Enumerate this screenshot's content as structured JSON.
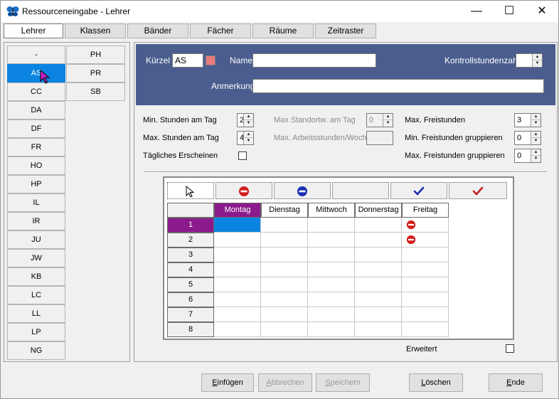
{
  "window": {
    "title": "Ressourceneingabe - Lehrer",
    "minimize": "—",
    "maximize": "☐",
    "close": "✕"
  },
  "tabs": [
    {
      "label": "Lehrer"
    },
    {
      "label": "Klassen"
    },
    {
      "label": "Bänder"
    },
    {
      "label": "Fächer"
    },
    {
      "label": "Räume"
    },
    {
      "label": "Zeitraster"
    }
  ],
  "teachers": {
    "col1": [
      "-",
      "AS",
      "CC",
      "DA",
      "DF",
      "FR",
      "HO",
      "HP",
      "IL",
      "IR",
      "JU",
      "JW",
      "KB",
      "LC",
      "LL",
      "LP",
      "NG"
    ],
    "col2": [
      "PH",
      "PR",
      "SB"
    ],
    "selected": "AS"
  },
  "header": {
    "kuerzel_label": "Kürzel",
    "kuerzel_value": "AS",
    "name_label": "Name",
    "name_value": "",
    "kontroll_label": "Kontrollstundenzahl",
    "kontroll_value": "",
    "anmerkung_label": "Anmerkung",
    "anmerkung_value": ""
  },
  "settings": {
    "min_stunden_label": "Min. Stunden am Tag",
    "min_stunden_value": "2",
    "max_stunden_label": "Max. Stunden am Tag",
    "max_stunden_value": "4",
    "taegliches_label": "Tägliches Erscheinen",
    "max_standortw_label": "Max Standortw. am Tag",
    "max_standortw_value": "0",
    "max_arbeits_label": "Max. Arbeitsstunden/Woch",
    "max_arbeits_value": "",
    "max_frei_label": "Max. Freistunden",
    "max_frei_value": "3",
    "min_frei_grp_label": "Min. Freistunden gruppieren",
    "min_frei_grp_value": "0",
    "max_frei_grp_label": "Max. Freistunden gruppieren",
    "max_frei_grp_value": "0"
  },
  "grid": {
    "days": [
      "Montag",
      "Dienstag",
      "Mittwoch",
      "Donnerstag",
      "Freitag"
    ],
    "periods": [
      "1",
      "2",
      "3",
      "4",
      "5",
      "6",
      "7",
      "8"
    ],
    "active_day": "Montag",
    "active_period": "1",
    "blocked": [
      {
        "day": "Freitag",
        "period": "1"
      },
      {
        "day": "Freitag",
        "period": "2"
      }
    ],
    "tool_icons": [
      "arrow-icon",
      "red-minus-icon",
      "blue-minus-icon",
      "empty",
      "blue-check-icon",
      "red-check-icon"
    ]
  },
  "erweitert_label": "Erweitert",
  "buttons": {
    "einfuegen_pre": "",
    "einfuegen_ul": "E",
    "einfuegen_post": "infügen",
    "abbrechen_pre": "",
    "abbrechen_ul": "A",
    "abbrechen_post": "bbrechen",
    "speichern_pre": "",
    "speichern_ul": "S",
    "speichern_post": "peichern",
    "loeschen_pre": "",
    "loeschen_ul": "L",
    "loeschen_post": "öschen",
    "ende_pre": "",
    "ende_ul": "E",
    "ende_post": "nde"
  },
  "colors": {
    "header_blue": "#4a5d8e",
    "selection_blue": "#0a84e0",
    "active_purple": "#8c1a8c",
    "blocked_red": "#d51f1f"
  }
}
